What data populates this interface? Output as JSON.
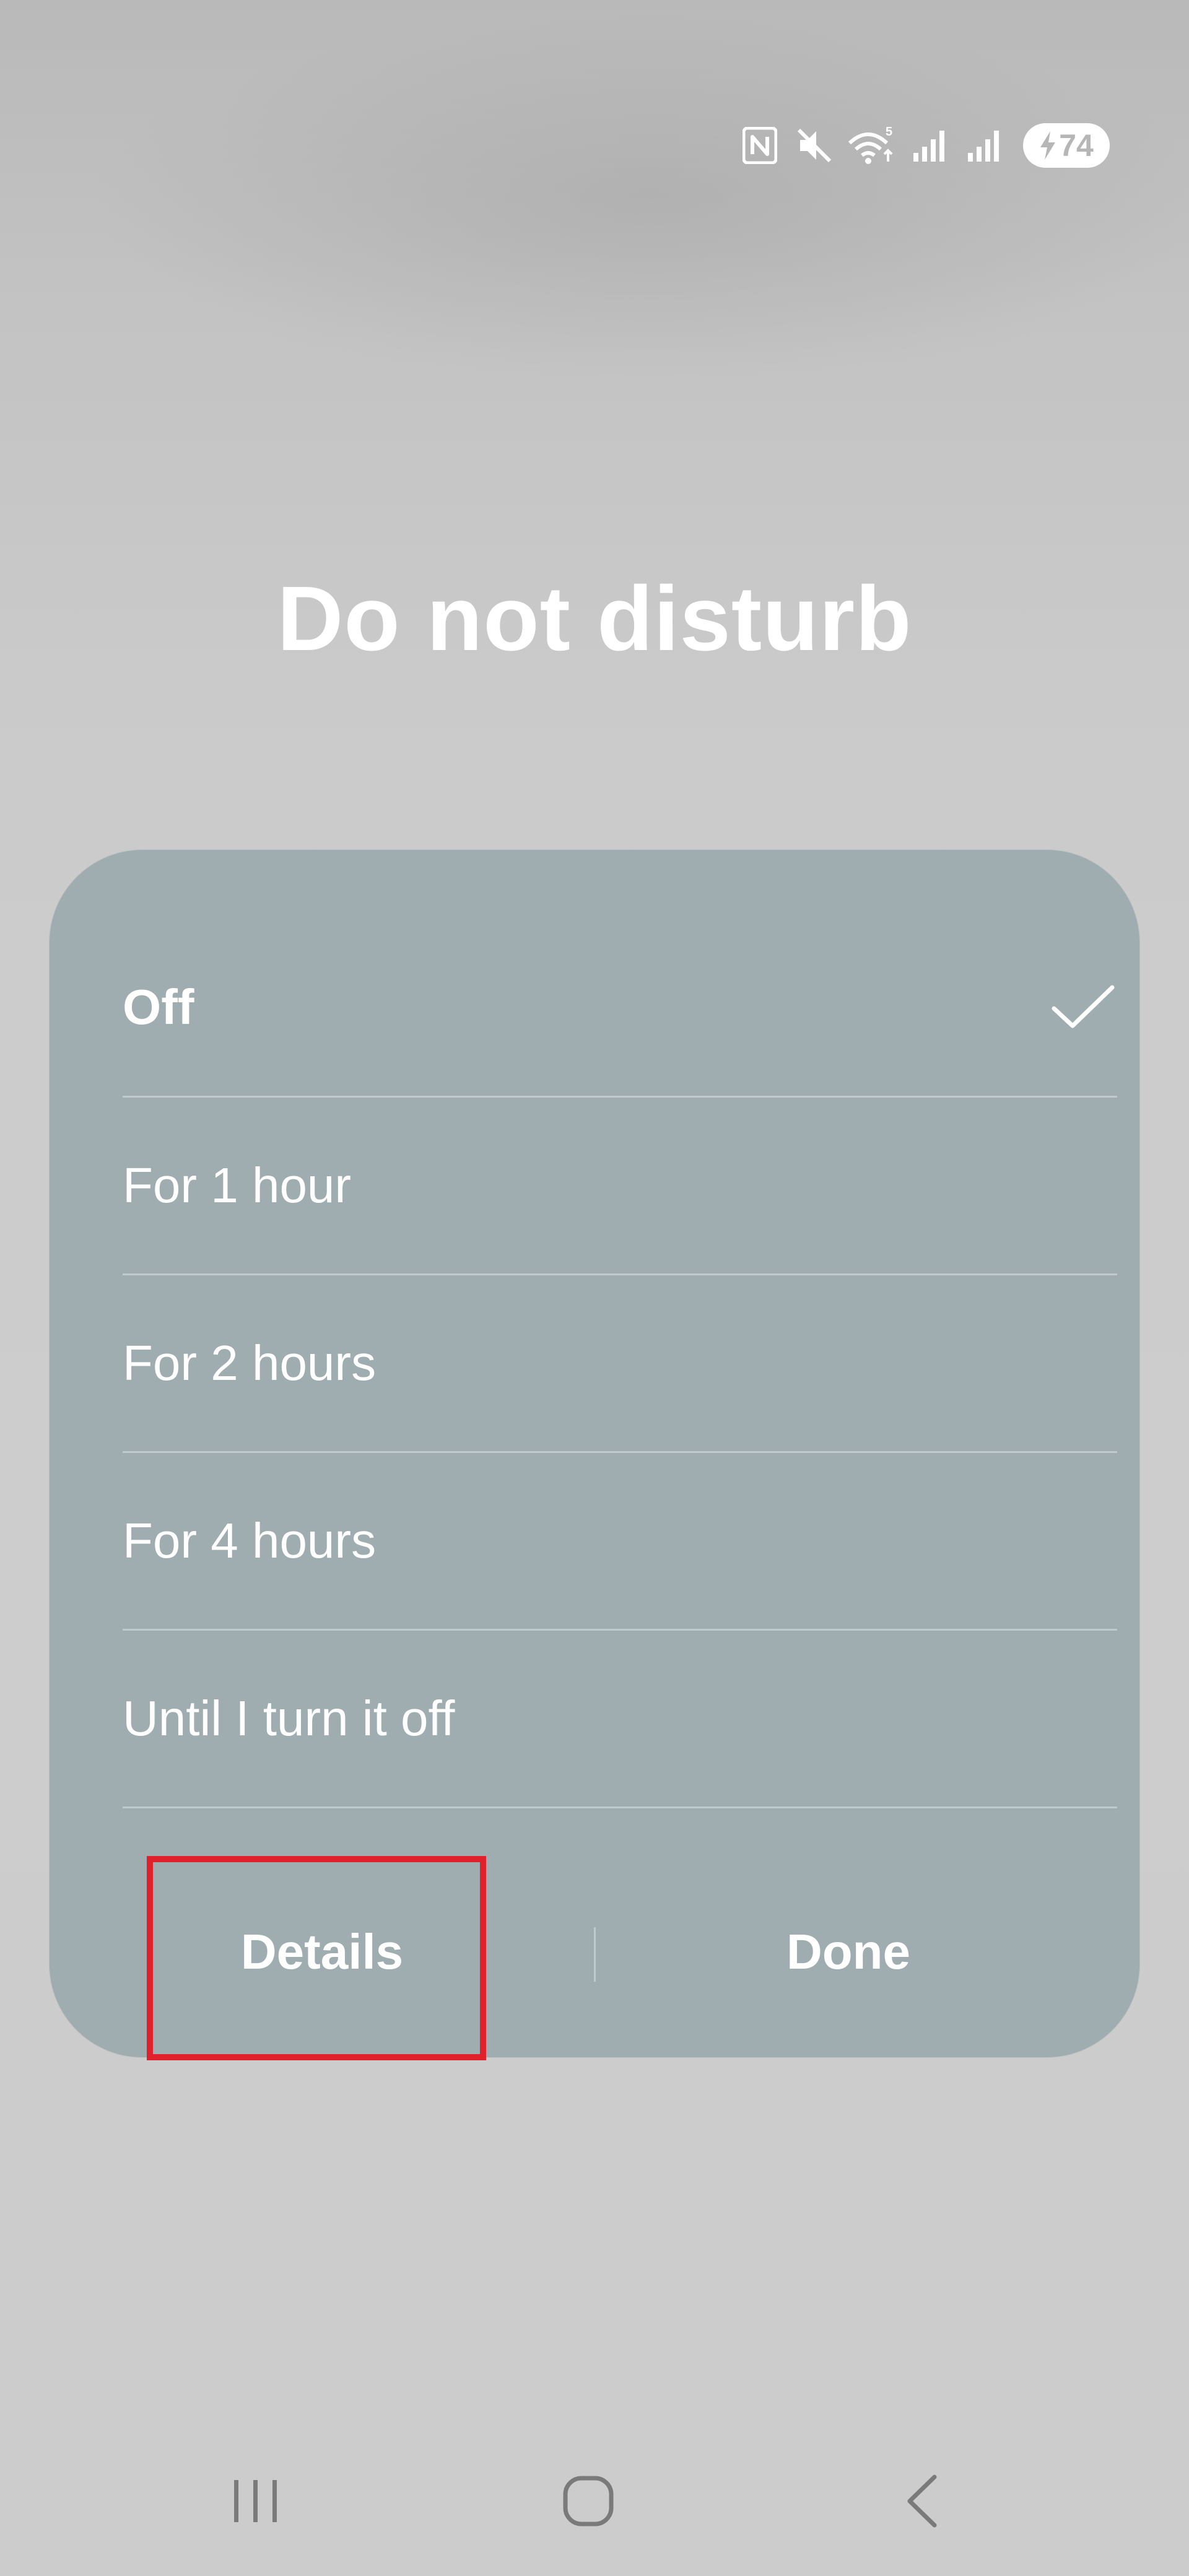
{
  "status_bar": {
    "icons": [
      "nfc-icon",
      "mute-icon",
      "wifi-icon",
      "signal-icon",
      "signal-icon"
    ],
    "wifi_badge": "5",
    "battery_level": "74",
    "battery_charging": true
  },
  "dialog": {
    "title": "Do not disturb",
    "options": [
      {
        "label": "Off",
        "selected": true
      },
      {
        "label": "For 1 hour",
        "selected": false
      },
      {
        "label": "For 2 hours",
        "selected": false
      },
      {
        "label": "For 4 hours",
        "selected": false
      },
      {
        "label": "Until I turn it off",
        "selected": false
      }
    ],
    "details_label": "Details",
    "done_label": "Done"
  },
  "colors": {
    "card_background": "#9fadb0",
    "highlight": "#e0202a",
    "text": "#ffffff"
  },
  "nav_bar": {
    "buttons": [
      "recent-apps-icon",
      "home-icon",
      "back-icon"
    ]
  }
}
